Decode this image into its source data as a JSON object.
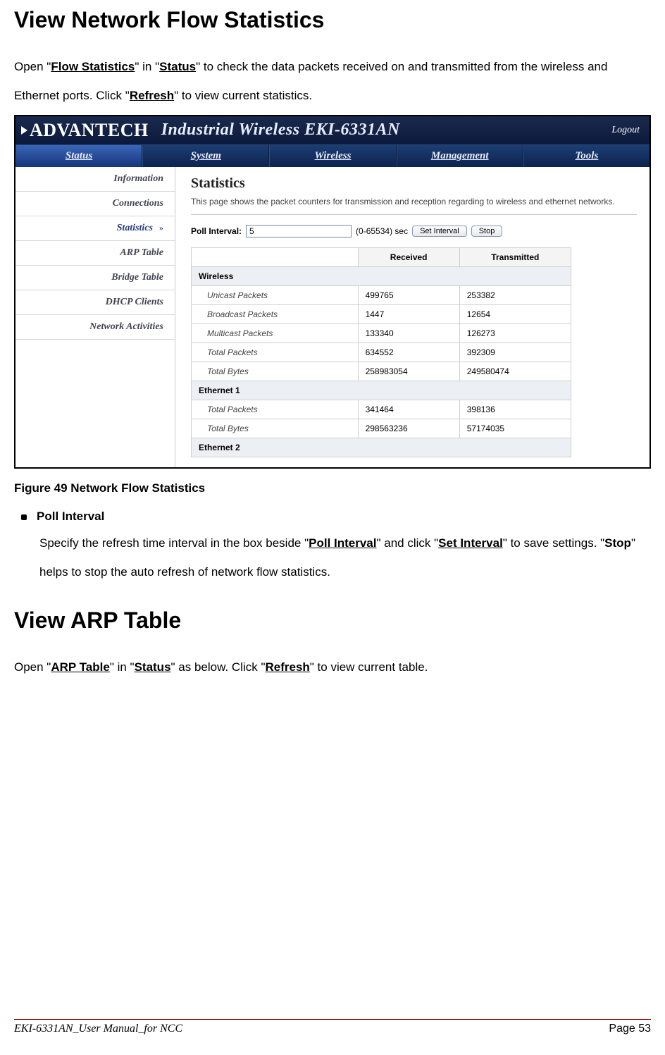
{
  "section1": {
    "title": "View Network Flow Statistics",
    "intro_parts": [
      "Open \"",
      "Flow Statistics",
      "\" in \"",
      "Status",
      "\" to check the data packets received on and transmitted from the wireless and Ethernet ports.    Click \"",
      "Refresh",
      "\" to view current statistics."
    ]
  },
  "screenshot": {
    "brand": "ADVANTECH",
    "product": "Industrial Wireless EKI-6331AN",
    "logout": "Logout",
    "tabs": [
      "Status",
      "System",
      "Wireless",
      "Management",
      "Tools"
    ],
    "active_tab": 0,
    "sidebar": [
      "Information",
      "Connections",
      "Statistics",
      "ARP Table",
      "Bridge Table",
      "DHCP Clients",
      "Network Activities"
    ],
    "sidebar_active": 2,
    "main_title": "Statistics",
    "main_desc": "This page shows the packet counters for transmission and reception regarding to wireless and ethernet networks.",
    "poll": {
      "label": "Poll Interval:",
      "value": "5",
      "range": "(0-65534) sec",
      "btn_set": "Set Interval",
      "btn_stop": "Stop"
    },
    "table": {
      "headers": [
        "",
        "Received",
        "Transmitted"
      ],
      "groups": [
        {
          "name": "Wireless",
          "rows": [
            {
              "metric": "Unicast Packets",
              "rx": "499765",
              "tx": "253382"
            },
            {
              "metric": "Broadcast Packets",
              "rx": "1447",
              "tx": "12654"
            },
            {
              "metric": "Multicast Packets",
              "rx": "133340",
              "tx": "126273"
            },
            {
              "metric": "Total Packets",
              "rx": "634552",
              "tx": "392309"
            },
            {
              "metric": "Total Bytes",
              "rx": "258983054",
              "tx": "249580474"
            }
          ]
        },
        {
          "name": "Ethernet 1",
          "rows": [
            {
              "metric": "Total Packets",
              "rx": "341464",
              "tx": "398136"
            },
            {
              "metric": "Total Bytes",
              "rx": "298563236",
              "tx": "57174035"
            }
          ]
        },
        {
          "name": "Ethernet 2",
          "rows": []
        }
      ]
    }
  },
  "figure_caption": "Figure 49 Network Flow Statistics",
  "bullet": {
    "title": "Poll Interval",
    "text_parts": [
      "Specify the refresh time interval in the box beside \"",
      "Poll Interval",
      "\" and click \"",
      "Set Interval",
      "\" to save settings. \"",
      "Stop",
      "\" helps to stop the auto refresh of network flow statistics."
    ]
  },
  "section2": {
    "title": "View ARP Table",
    "intro_parts": [
      "Open \"",
      "ARP Table",
      "\" in \"",
      "Status",
      "\" as below.    Click \"",
      "Refresh",
      "\" to view current table."
    ]
  },
  "footer": {
    "left": "EKI-6331AN_User Manual_for NCC",
    "right": "Page 53"
  }
}
